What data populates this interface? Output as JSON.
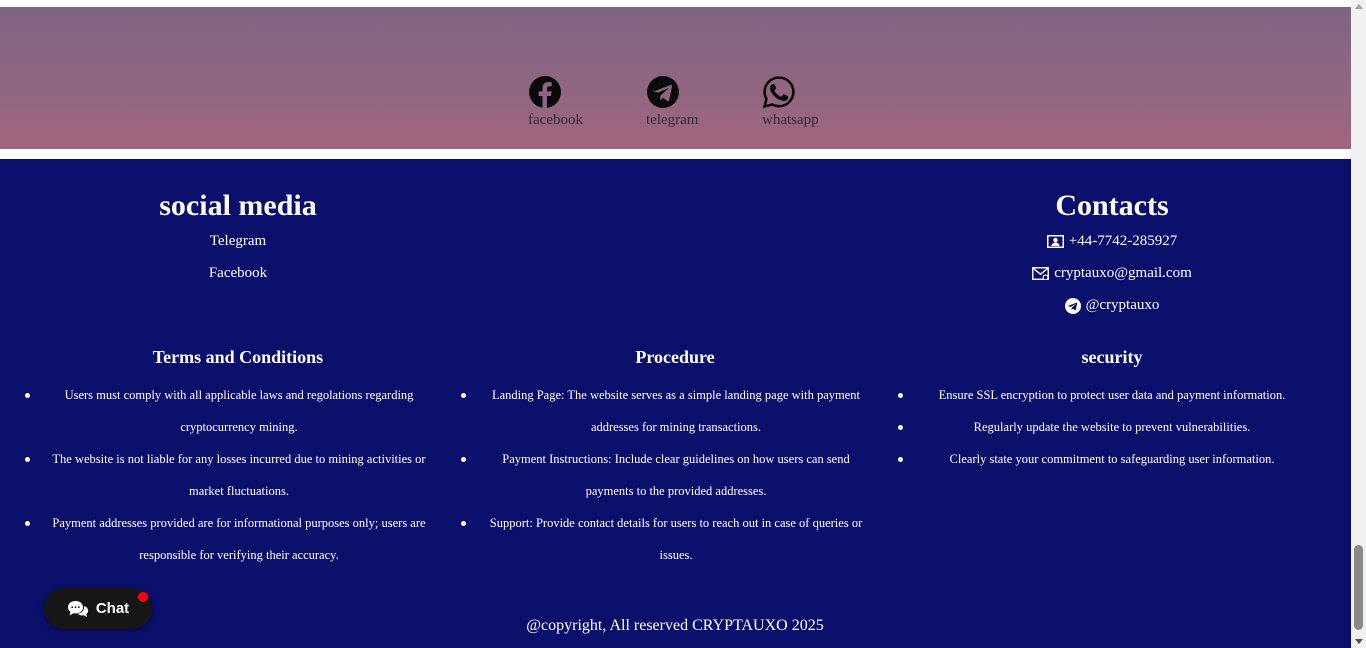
{
  "social_band": {
    "links": [
      {
        "label": "facebook",
        "icon": "facebook-icon"
      },
      {
        "label": "telegram",
        "icon": "telegram-icon"
      },
      {
        "label": "whatsapp",
        "icon": "whatsapp-icon"
      }
    ]
  },
  "footer": {
    "social_media": {
      "title": "social media",
      "links": [
        "Telegram",
        "Facebook"
      ]
    },
    "contacts": {
      "title": "Contacts",
      "phone": "+44-7742-285927",
      "email": "cryptauxo@gmail.com",
      "telegram": "@cryptauxo"
    },
    "terms": {
      "title": "Terms and Conditions",
      "items": [
        "Users must comply with all applicable laws and regolations regarding cryptocurrency mining.",
        "The website is not liable for any losses incurred due to mining activities or market fluctuations.",
        "Payment addresses provided are for informational purposes only; users are responsible for verifying their accuracy."
      ]
    },
    "procedure": {
      "title": "Procedure",
      "items": [
        "Landing Page: The website serves as a simple landing page with payment addresses for mining transactions.",
        "Payment Instructions: Include clear guidelines on how users can send payments to the provided addresses.",
        "Support: Provide contact details for users to reach out in case of queries or issues."
      ]
    },
    "security": {
      "title": "security",
      "items": [
        "Ensure SSL encryption to protect user data and payment information.",
        "Regularly update the website to prevent vulnerabilities.",
        "Clearly state your commitment to safeguarding user information."
      ]
    },
    "copyright": "@copyright, All reserved CRYPTAUXO 2025"
  },
  "chat": {
    "label": "Chat",
    "icon": "chat-bubble-icon"
  },
  "colors": {
    "footer_bg": "#0b0f6c",
    "band_top": "#7d6582",
    "band_bottom": "#a0657f",
    "chat_bg": "#161616",
    "notification_dot": "#ff0000"
  }
}
